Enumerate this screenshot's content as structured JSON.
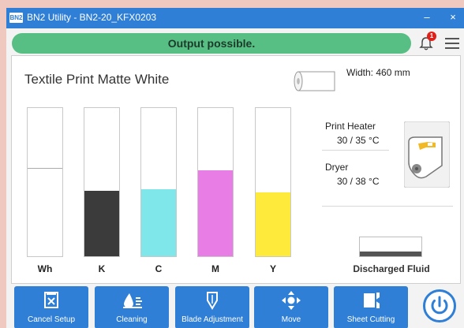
{
  "window": {
    "app_logo": "BN2",
    "title": "BN2 Utility - BN2-20_KFX0203",
    "minimize": "–",
    "close": "×"
  },
  "status": {
    "message": "Output possible.",
    "color": "#57bf84",
    "notification_count": "1"
  },
  "media": {
    "name": "Textile Print Matte White",
    "width_label": "Width: 460 mm"
  },
  "inks": [
    {
      "label": "Wh",
      "level": 0.59,
      "color": "#ffffff"
    },
    {
      "label": "K",
      "level": 0.44,
      "color": "#3b3b3b"
    },
    {
      "label": "C",
      "level": 0.45,
      "color": "#7fe6ea"
    },
    {
      "label": "M",
      "level": 0.58,
      "color": "#e97de6"
    },
    {
      "label": "Y",
      "level": 0.43,
      "color": "#fdea3b"
    }
  ],
  "heater": {
    "print_heater_label": "Print Heater",
    "print_heater_value": "30 / 35 °C",
    "dryer_label": "Dryer",
    "dryer_value": "30 / 38 °C"
  },
  "discharged": {
    "label": "Discharged Fluid",
    "level": 0.25
  },
  "actions": [
    {
      "label": "Cancel Setup",
      "icon": "cancel-setup-icon"
    },
    {
      "label": "Cleaning",
      "icon": "cleaning-icon"
    },
    {
      "label": "Blade Adjustment",
      "icon": "blade-icon"
    },
    {
      "label": "Move",
      "icon": "move-icon"
    },
    {
      "label": "Sheet Cutting",
      "icon": "sheet-cutting-icon"
    }
  ],
  "colors": {
    "accent": "#2f7fd6",
    "notification": "#e0201b"
  }
}
